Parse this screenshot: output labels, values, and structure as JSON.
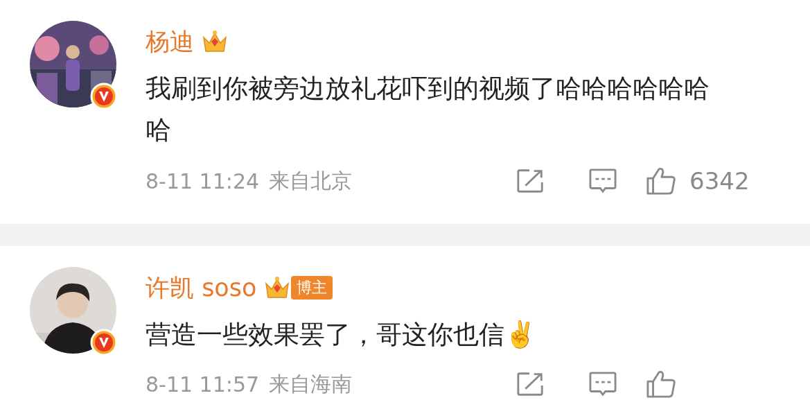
{
  "comments": [
    {
      "author": "杨迪",
      "text": "我刷到你被旁边放礼花吓到的视频了哈哈哈哈哈哈哈",
      "time": "8-11 11:24",
      "location": "来自北京",
      "likes": "6342"
    },
    {
      "author": "许凯 soso",
      "badge": "博主",
      "text": "营造一些效果罢了，哥这你也信✌️",
      "time": "8-11 11:57",
      "location": "来自海南"
    }
  ]
}
